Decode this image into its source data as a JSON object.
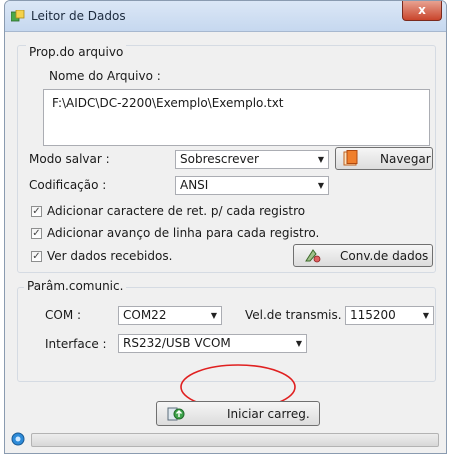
{
  "window": {
    "title": "Leitor de Dados",
    "close_label": "x"
  },
  "file_group": {
    "title": "Prop.do arquivo",
    "filename_label": "Nome do Arquivo :",
    "filename_value": "F:\\AIDC\\DC-2200\\Exemplo\\Exemplo.txt",
    "save_mode_label": "Modo salvar :",
    "save_mode_value": "Sobrescrever",
    "browse_label": "Navegar",
    "encoding_label": "Codificação :",
    "encoding_value": "ANSI",
    "checkboxes": [
      {
        "label": "Adicionar caractere de ret. p/ cada registro",
        "checked": true
      },
      {
        "label": "Adicionar avanço de linha para cada registro.",
        "checked": true
      },
      {
        "label": "Ver dados recebidos.",
        "checked": true
      }
    ],
    "convert_label": "Conv.de dados"
  },
  "comm_group": {
    "title": "Parâm.comunic.",
    "com_label": "COM :",
    "com_value": "COM22",
    "baud_label": "Vel.de transmis.",
    "baud_value": "115200",
    "interface_label": "Interface :",
    "interface_value": "RS232/USB VCOM"
  },
  "actions": {
    "start_label": "Iniciar carreg."
  },
  "status": {
    "progress": 0
  },
  "colors": {
    "annotation": "#e02020",
    "title_bar": "#c6d8ef",
    "close_button": "#c9452c"
  },
  "icons": {
    "app": "app-data-icon",
    "browse": "folder-icon",
    "convert": "convert-icon",
    "start": "upload-icon",
    "status": "connection-icon"
  }
}
